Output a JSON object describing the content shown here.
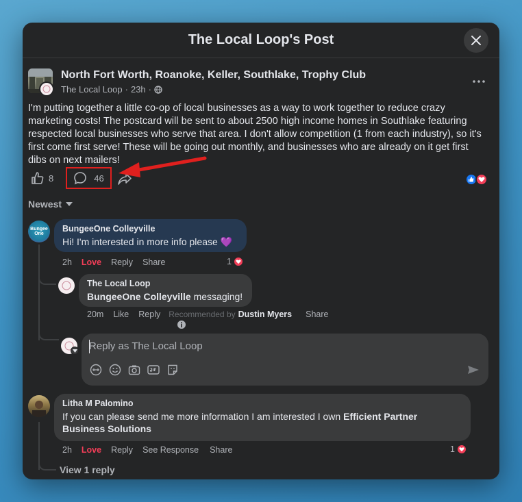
{
  "modal": {
    "title": "The Local Loop's Post"
  },
  "post": {
    "group_name": "North Fort Worth, Roanoke, Keller, Southlake, Trophy Club",
    "author": "The Local Loop",
    "time": "23h",
    "separator": "·",
    "text": "I'm putting together a little co-op of local businesses as a way to work together to reduce crazy marketing costs! The postcard will be sent to about 2500 high income homes in Southlake  featuring respected local businesses who serve that area. I don't allow competition (1 from each industry), so it's first come first serve! These will be going out monthly, and businesses who are already on it get first dibs on next mailers!",
    "like_count": "8",
    "comment_count": "46",
    "reactions": [
      "like-icon",
      "love-icon"
    ]
  },
  "comments_sort": {
    "label": "Newest"
  },
  "comments": [
    {
      "name": "BungeeOne Colleyville",
      "text": "Hi! I'm interested in more info please 💜",
      "time": "2h",
      "love": "Love",
      "reply": "Reply",
      "share": "Share",
      "reaction_count": "1",
      "avatar_text": "Bungee One"
    },
    {
      "name": "The Local Loop",
      "text_bold": "BungeeOne Colleyville",
      "text_rest": " messaging!",
      "time": "20m",
      "like": "Like",
      "reply": "Reply",
      "recommended": "Recommended by",
      "recommended_name": "Dustin Myers",
      "share": "Share"
    },
    {
      "name": "Litha M Palomino",
      "text_plain": "If you can please send me more information I am interested I own ",
      "text_bold": "Efficient Partner Business Solutions",
      "time": "2h",
      "love": "Love",
      "reply": "Reply",
      "see_response": "See Response",
      "share": "Share",
      "reaction_count": "1",
      "view_replies": "View 1 reply"
    }
  ],
  "reply_box": {
    "placeholder": "Reply as The Local Loop",
    "tools": [
      "avatar-sticker-icon",
      "emoji-icon",
      "camera-icon",
      "gif-icon",
      "sticker-icon"
    ]
  },
  "colors": {
    "accent_red": "#e0201e",
    "love": "#f33e58",
    "like_blue": "#1877f2"
  }
}
